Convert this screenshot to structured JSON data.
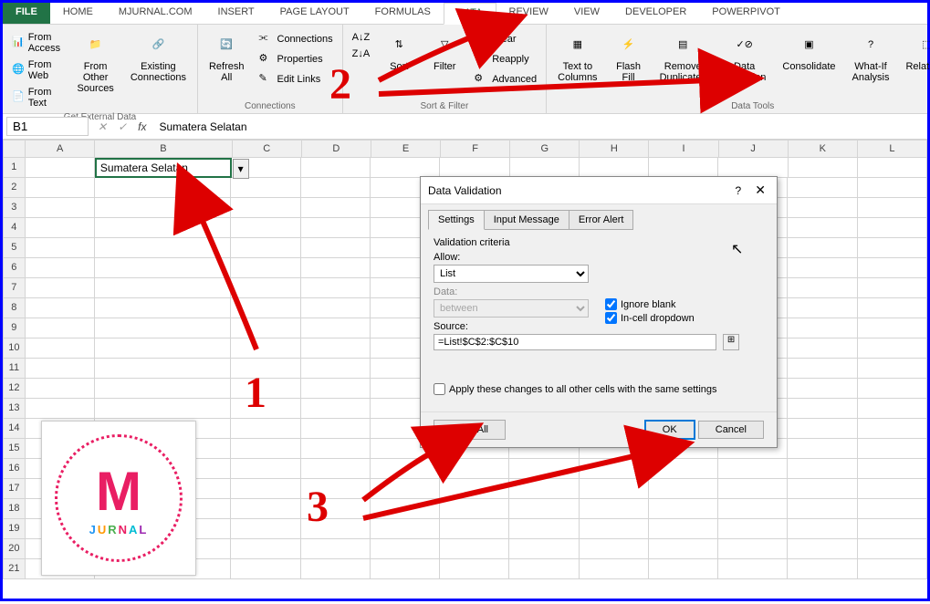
{
  "ribbon": {
    "tabs": [
      "FILE",
      "HOME",
      "MJURNAL.COM",
      "INSERT",
      "PAGE LAYOUT",
      "FORMULAS",
      "DATA",
      "REVIEW",
      "VIEW",
      "DEVELOPER",
      "POWERPIVOT"
    ],
    "active": "DATA",
    "getExternal": {
      "fromAccess": "From Access",
      "fromWeb": "From Web",
      "fromText": "From Text",
      "fromOther": "From Other\nSources",
      "existing": "Existing\nConnections",
      "label": "Get External Data"
    },
    "connections": {
      "refresh": "Refresh\nAll",
      "conn": "Connections",
      "prop": "Properties",
      "edit": "Edit Links",
      "label": "Connections"
    },
    "sortFilter": {
      "sortAZ": "A↓Z",
      "sortZA": "Z↓A",
      "sort": "Sort",
      "filter": "Filter",
      "clear": "Clear",
      "reapply": "Reapply",
      "advanced": "Advanced",
      "label": "Sort & Filter"
    },
    "dataTools": {
      "textCols": "Text to\nColumns",
      "flashFill": "Flash\nFill",
      "removeDup": "Remove\nDuplicates",
      "validation": "Data\nValidation",
      "consolidate": "Consolidate",
      "whatIf": "What-If\nAnalysis",
      "relations": "Relations",
      "label": "Data Tools"
    }
  },
  "formulaBar": {
    "nameBox": "B1",
    "formula": "Sumatera Selatan"
  },
  "grid": {
    "cols": [
      "A",
      "B",
      "C",
      "D",
      "E",
      "F",
      "G",
      "H",
      "I",
      "J",
      "K",
      "L"
    ],
    "activeCell": "Sumatera Selatan",
    "rowCount": 21
  },
  "dialog": {
    "title": "Data Validation",
    "tabs": [
      "Settings",
      "Input Message",
      "Error Alert"
    ],
    "criteria": "Validation criteria",
    "allowLabel": "Allow:",
    "allowValue": "List",
    "dataLabel": "Data:",
    "dataValue": "between",
    "sourceLabel": "Source:",
    "sourceValue": "=List!$C$2:$C$10",
    "ignoreBlank": "Ignore blank",
    "inCell": "In-cell dropdown",
    "applyAll": "Apply these changes to all other cells with the same settings",
    "clearAll": "Clear All",
    "ok": "OK",
    "cancel": "Cancel"
  },
  "annotations": {
    "n1": "1",
    "n2": "2",
    "n3": "3"
  },
  "watermark": {
    "letter": "M",
    "word": "JURNAL"
  }
}
